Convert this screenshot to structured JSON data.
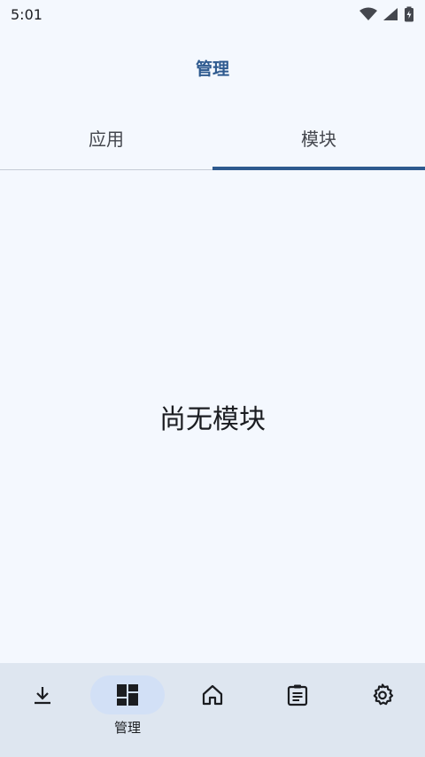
{
  "status_bar": {
    "time": "5:01",
    "icons": [
      "wifi-icon",
      "signal-icon",
      "battery-charging-icon"
    ]
  },
  "header": {
    "title": "管理"
  },
  "tabs": [
    {
      "label": "应用",
      "active": false
    },
    {
      "label": "模块",
      "active": true
    }
  ],
  "content": {
    "empty_message": "尚无模块"
  },
  "bottom_nav": {
    "items": [
      {
        "icon": "download-icon",
        "label": "",
        "active": false
      },
      {
        "icon": "dashboard-icon",
        "label": "管理",
        "active": true
      },
      {
        "icon": "home-icon",
        "label": "",
        "active": false
      },
      {
        "icon": "clipboard-icon",
        "label": "",
        "active": false
      },
      {
        "icon": "settings-icon",
        "label": "",
        "active": false
      }
    ]
  },
  "colors": {
    "background": "#f4f8fe",
    "accent": "#2e5a8f",
    "nav_background": "#dee6f0",
    "nav_active_pill": "#d2e0f6"
  }
}
